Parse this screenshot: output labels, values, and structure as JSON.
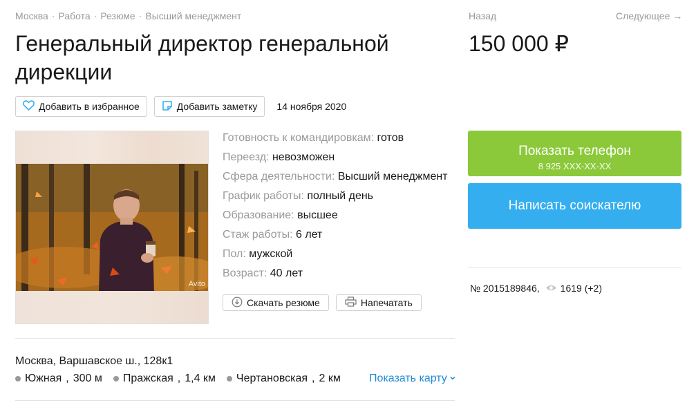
{
  "breadcrumb": {
    "items": [
      "Москва",
      "Работа",
      "Резюме",
      "Высший менеджмент"
    ],
    "separator": "·"
  },
  "title": "Генеральный директор генеральной дирекции",
  "actions": {
    "favorite_label": "Добавить в избранное",
    "note_label": "Добавить заметку",
    "date": "14 ноября 2020"
  },
  "photo": {
    "watermark": "Avito"
  },
  "params": [
    {
      "label": "Готовность к командировкам:",
      "value": "готов"
    },
    {
      "label": "Переезд:",
      "value": "невозможен"
    },
    {
      "label": "Сфера деятельности:",
      "value": "Высший менеджмент"
    },
    {
      "label": "График работы:",
      "value": "полный день"
    },
    {
      "label": "Образование:",
      "value": "высшее"
    },
    {
      "label": "Стаж работы:",
      "value": "6 лет"
    },
    {
      "label": "Пол:",
      "value": "мужской"
    },
    {
      "label": "Возраст:",
      "value": "40 лет"
    }
  ],
  "doc_actions": {
    "download_label": "Скачать резюме",
    "print_label": "Напечатать"
  },
  "location": {
    "address": "Москва, Варшавское ш., 128к1",
    "metro": [
      {
        "name": "Южная",
        "distance": "300 м"
      },
      {
        "name": "Пражская",
        "distance": "1,4 км"
      },
      {
        "name": "Чертановская",
        "distance": "2 км"
      }
    ],
    "map_link": "Показать карту"
  },
  "nav": {
    "back": "Назад",
    "next": "Следующее",
    "next_arrow": "→"
  },
  "price": "150 000 ₽",
  "contact": {
    "phone_label": "Показать телефон",
    "phone_masked": "8 925 XXX-XX-XX",
    "message_label": "Написать соискателю"
  },
  "ad_info": {
    "number": "№ 2015189846,",
    "views": "1619 (+2)"
  },
  "colors": {
    "accent_green": "#8bc93a",
    "accent_blue": "#35aef0",
    "link": "#1d8ad6",
    "muted": "#999999"
  }
}
